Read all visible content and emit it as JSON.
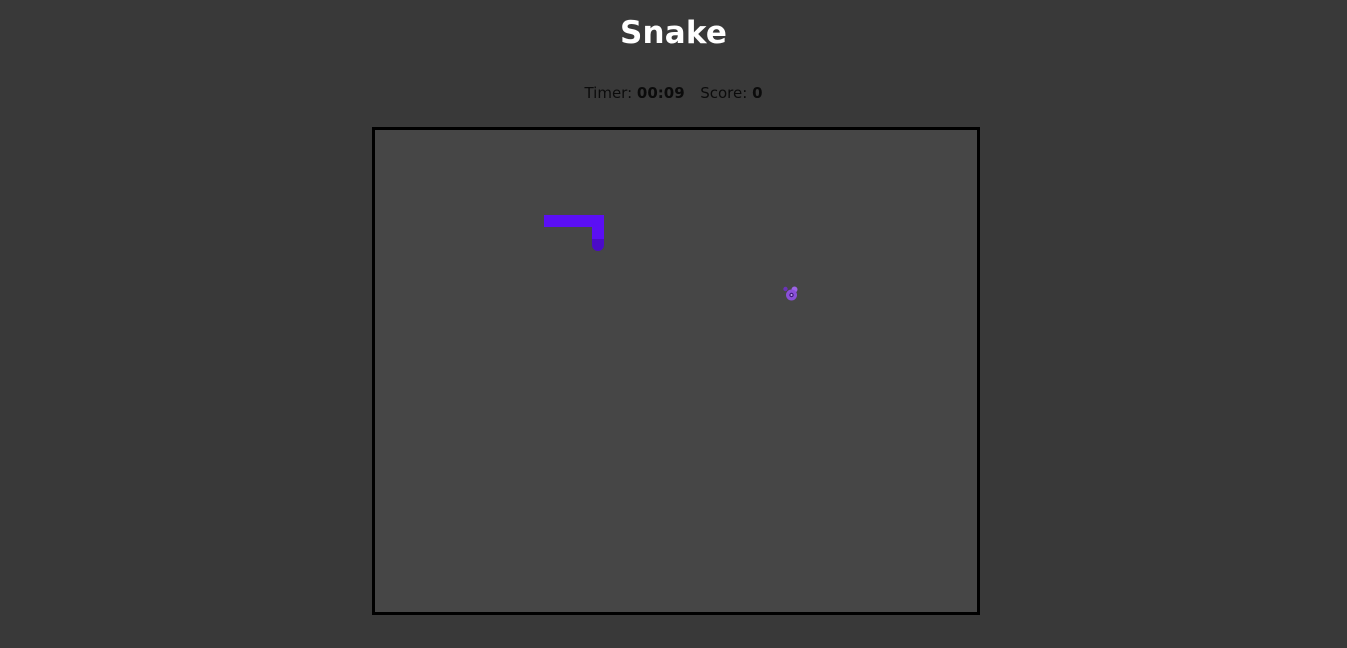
{
  "header": {
    "title": "Snake"
  },
  "stats": {
    "timer_label": "Timer:",
    "timer_value": "00:09",
    "score_label": "Score:",
    "score_value": "0"
  },
  "colors": {
    "background": "#393939",
    "board": "#464646",
    "border": "#000000",
    "snake_body": "#5b0ff4",
    "snake_head": "#4b0bc8",
    "food": "#8a4fd8"
  },
  "game": {
    "food_icon": "donut-icon"
  }
}
